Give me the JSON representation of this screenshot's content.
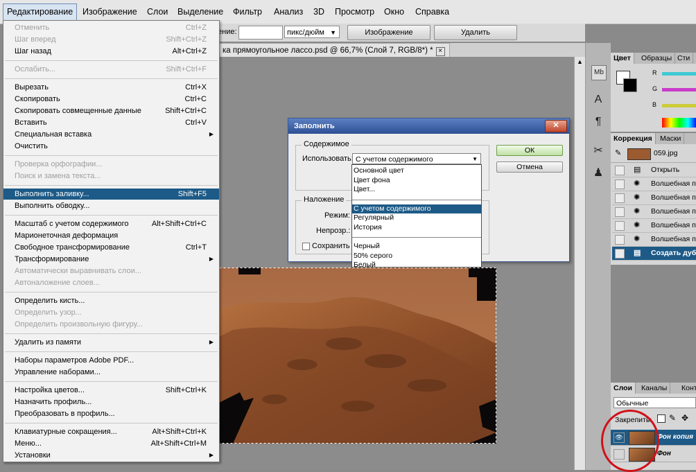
{
  "menubar": {
    "items": [
      "Редактирование",
      "Изображение",
      "Слои",
      "Выделение",
      "Фильтр",
      "Анализ",
      "3D",
      "Просмотр",
      "Окно",
      "Справка"
    ]
  },
  "options_bar": {
    "partial_label": "ение:",
    "units_select": "пикс/дюйм",
    "image_button": "Изображение",
    "delete_button": "Удалить"
  },
  "document": {
    "tab_title": "ка прямоугольное лассо.psd @ 66,7% (Слой 7, RGB/8*) *",
    "close_glyph": "×"
  },
  "edit_menu": {
    "items": [
      {
        "label": "Отменить",
        "shortcut": "Ctrl+Z",
        "disabled": true
      },
      {
        "label": "Шаг вперед",
        "shortcut": "Shift+Ctrl+Z",
        "disabled": true
      },
      {
        "label": "Шаг назад",
        "shortcut": "Alt+Ctrl+Z"
      },
      {
        "sep": true
      },
      {
        "label": "Ослабить...",
        "shortcut": "Shift+Ctrl+F",
        "disabled": true
      },
      {
        "sep": true
      },
      {
        "label": "Вырезать",
        "shortcut": "Ctrl+X"
      },
      {
        "label": "Скопировать",
        "shortcut": "Ctrl+C"
      },
      {
        "label": "Скопировать совмещенные данные",
        "shortcut": "Shift+Ctrl+C"
      },
      {
        "label": "Вставить",
        "shortcut": "Ctrl+V"
      },
      {
        "label": "Специальная вставка",
        "submenu": true
      },
      {
        "label": "Очистить"
      },
      {
        "sep": true
      },
      {
        "label": "Проверка орфографии...",
        "disabled": true
      },
      {
        "label": "Поиск и замена текста...",
        "disabled": true
      },
      {
        "sep": true
      },
      {
        "label": "Выполнить заливку...",
        "shortcut": "Shift+F5",
        "highlighted": true
      },
      {
        "label": "Выполнить обводку..."
      },
      {
        "sep": true
      },
      {
        "label": "Масштаб с учетом содержимого",
        "shortcut": "Alt+Shift+Ctrl+C"
      },
      {
        "label": "Марионеточная деформация"
      },
      {
        "label": "Свободное трансформирование",
        "shortcut": "Ctrl+T"
      },
      {
        "label": "Трансформирование",
        "submenu": true
      },
      {
        "label": "Автоматически выравнивать слои...",
        "disabled": true
      },
      {
        "label": "Автоналожение слоев...",
        "disabled": true
      },
      {
        "sep": true
      },
      {
        "label": "Определить кисть..."
      },
      {
        "label": "Определить узор...",
        "disabled": true
      },
      {
        "label": "Определить произвольную фигуру...",
        "disabled": true
      },
      {
        "sep": true
      },
      {
        "label": "Удалить из памяти",
        "submenu": true
      },
      {
        "sep": true
      },
      {
        "label": "Наборы параметров Adobe PDF..."
      },
      {
        "label": "Управление наборами..."
      },
      {
        "sep": true
      },
      {
        "label": "Настройка цветов...",
        "shortcut": "Shift+Ctrl+K"
      },
      {
        "label": "Назначить профиль..."
      },
      {
        "label": "Преобразовать в профиль..."
      },
      {
        "sep": true
      },
      {
        "label": "Клавиатурные сокращения...",
        "shortcut": "Alt+Shift+Ctrl+K"
      },
      {
        "label": "Меню...",
        "shortcut": "Alt+Shift+Ctrl+M"
      },
      {
        "label": "Установки",
        "submenu": true
      }
    ]
  },
  "fill_dialog": {
    "title": "Заполнить",
    "close_glyph": "✕",
    "contents_legend": "Содержимое",
    "use_label": "Использовать:",
    "use_value": "С учетом содержимого",
    "blending_legend": "Наложение",
    "mode_label": "Режим:",
    "opacity_label": "Непрозр.:",
    "preserve_label": "Сохранить п",
    "ok_label": "ОК",
    "cancel_label": "Отмена",
    "options": [
      {
        "label": "Основной цвет"
      },
      {
        "label": "Цвет фона"
      },
      {
        "label": "Цвет..."
      },
      {
        "sep": true
      },
      {
        "label": "С учетом содержимого",
        "selected": true
      },
      {
        "label": "Регулярный"
      },
      {
        "label": "История"
      },
      {
        "sep": true
      },
      {
        "label": "Черный"
      },
      {
        "label": "50% серого"
      },
      {
        "label": "Белый"
      }
    ]
  },
  "right_panel": {
    "color_tabs": [
      "Цвет",
      "Образцы",
      "Сти"
    ],
    "channels": [
      "R",
      "G",
      "B"
    ],
    "colors": {
      "r": "#3fc9d4",
      "g": "#c83cc8",
      "b": "#cccc3a"
    },
    "adjust_tabs": [
      "Коррекция",
      "Маски"
    ],
    "history_snapshot": "059.jpg",
    "history": [
      {
        "label": "Открыть"
      },
      {
        "label": "Волшебная пал"
      },
      {
        "label": "Волшебная пал"
      },
      {
        "label": "Волшебная пал"
      },
      {
        "label": "Волшебная пал"
      },
      {
        "label": "Волшебная пал"
      },
      {
        "label": "Создать дубл",
        "selected": true
      }
    ],
    "layers_tabs": [
      "Слои",
      "Каналы",
      "Конт"
    ],
    "blend_mode": "Обычные",
    "lock_label": "Закрепить:",
    "layers": [
      {
        "name": "Фон копия",
        "visible": true,
        "selected": true
      },
      {
        "name": "Фон",
        "visible": false,
        "selected": false
      }
    ]
  },
  "tools": [
    "mini-bridge-icon",
    "character-icon",
    "paragraph-icon",
    "tools-icon",
    "stamp-icon"
  ]
}
